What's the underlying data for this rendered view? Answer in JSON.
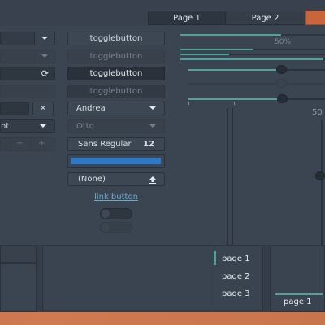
{
  "notebook": {
    "tabs": [
      {
        "label": "Page 1"
      },
      {
        "label": "Page 2"
      }
    ]
  },
  "left_column": {
    "search_input_value": "",
    "password_input_value": "",
    "combo_entry_text": "nt",
    "spin_minus_icon": "−",
    "spin_plus_icon": "+",
    "clear_icon": "×",
    "refresh_icon": "⟳"
  },
  "middle_column": {
    "toggle_buttons": [
      {
        "label": "togglebutton",
        "state": "normal"
      },
      {
        "label": "togglebutton",
        "state": "disabled"
      },
      {
        "label": "togglebutton",
        "state": "pressed"
      },
      {
        "label": "togglebutton",
        "state": "disabled-pressed"
      }
    ],
    "combo_andrea": "Andrea",
    "combo_otto": "Otto",
    "font_button": {
      "family": "Sans Regular",
      "size": "12"
    },
    "color_button": {
      "color": "#2f78c4"
    },
    "file_chooser": {
      "label": "(None)",
      "icon": "upload-icon"
    },
    "link_button": "link button"
  },
  "right_column": {
    "progress_label": "50%",
    "vertical_scale_label": "50",
    "progress_fraction": 0.5,
    "scale_values": [
      0.5,
      0.5,
      0.5
    ]
  },
  "bottom": {
    "sidebar_pages": [
      "page 1",
      "page 2",
      "page 3"
    ],
    "notebook_tab": "page 1"
  },
  "colors": {
    "background": "#3b4552",
    "accent": "#4fa39c",
    "selection": "#2f78c4",
    "link": "#6aa9d0",
    "wallpaper": "#c8744c"
  }
}
